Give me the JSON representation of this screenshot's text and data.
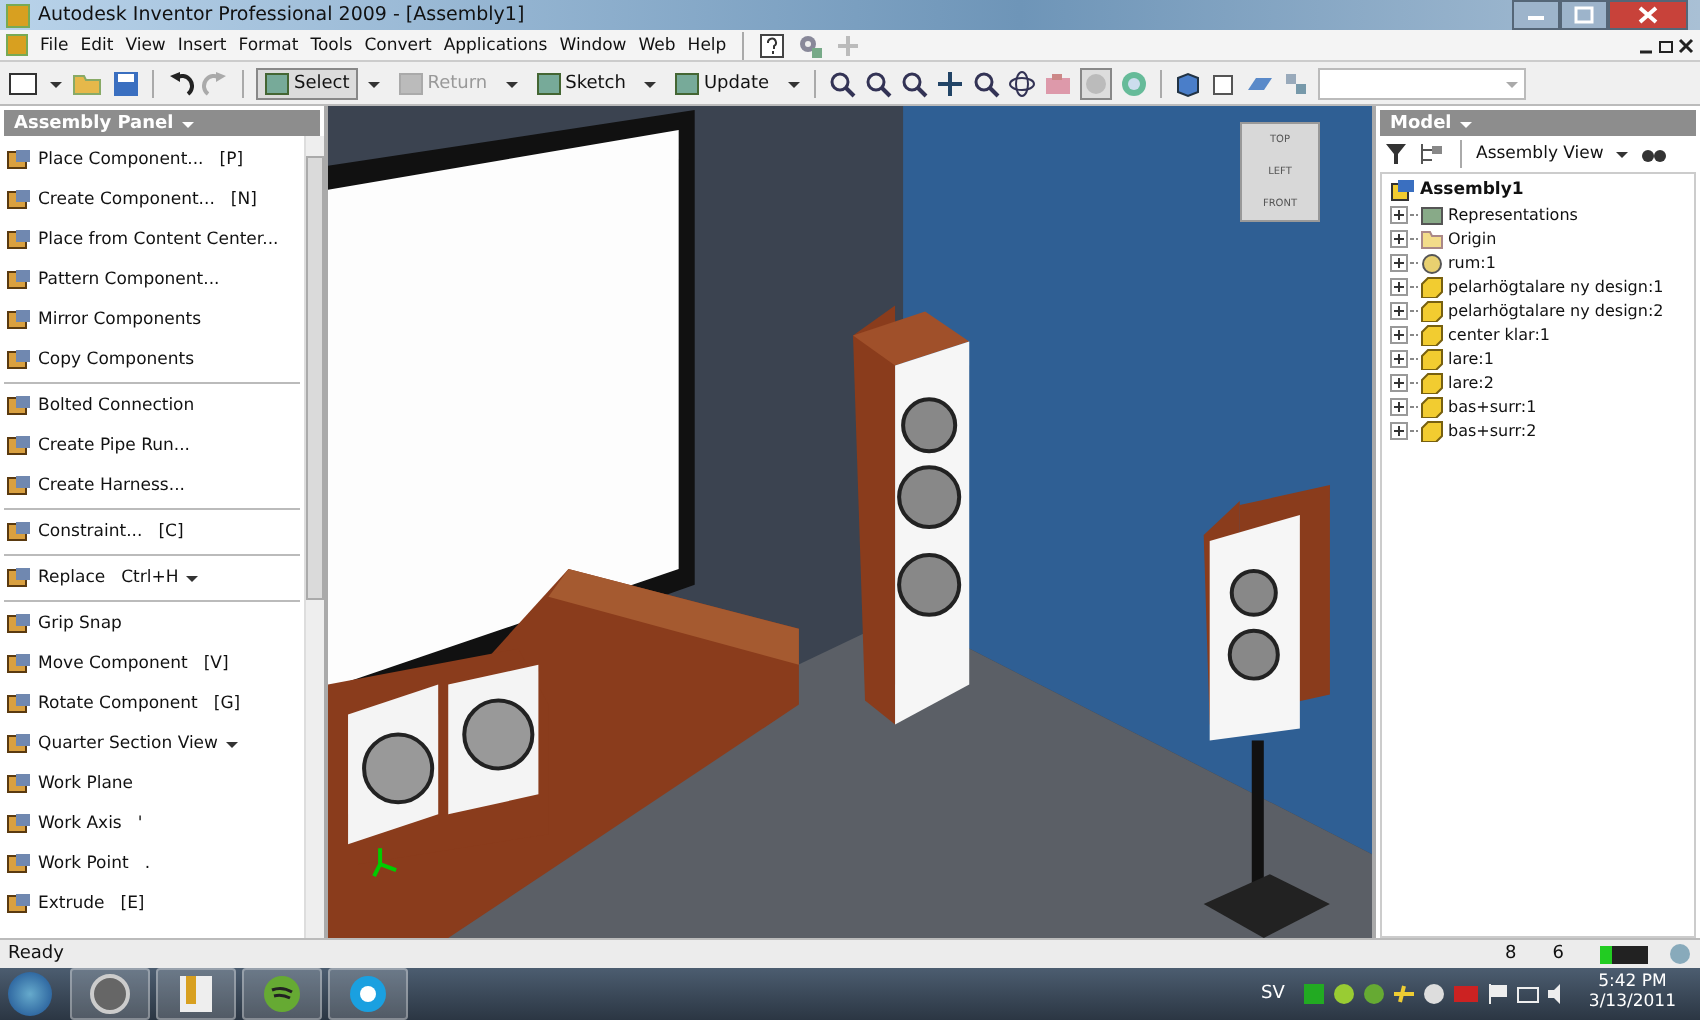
{
  "window": {
    "title": "Autodesk Inventor Professional 2009 - [Assembly1]"
  },
  "menu": [
    "File",
    "Edit",
    "View",
    "Insert",
    "Format",
    "Tools",
    "Convert",
    "Applications",
    "Window",
    "Web",
    "Help"
  ],
  "toolbar": [
    {
      "label": "Select",
      "pressed": true,
      "disabled": false
    },
    {
      "label": "Return",
      "pressed": false,
      "disabled": true
    },
    {
      "label": "Sketch",
      "pressed": false,
      "disabled": false
    },
    {
      "label": "Update",
      "pressed": false,
      "disabled": false
    }
  ],
  "assembly_panel": {
    "title": "Assembly Panel",
    "groups": [
      [
        {
          "label": "Place Component...",
          "shortcut": "[P]",
          "dropdown": false
        },
        {
          "label": "Create Component...",
          "shortcut": "[N]",
          "dropdown": false
        },
        {
          "label": "Place from Content Center...",
          "dropdown": false
        },
        {
          "label": "Pattern Component...",
          "dropdown": false
        },
        {
          "label": "Mirror Components",
          "dropdown": false
        },
        {
          "label": "Copy Components",
          "dropdown": false
        }
      ],
      [
        {
          "label": "Bolted Connection",
          "dropdown": false
        },
        {
          "label": "Create Pipe Run...",
          "dropdown": false
        },
        {
          "label": "Create Harness...",
          "dropdown": false
        }
      ],
      [
        {
          "label": "Constraint...",
          "shortcut": "[C]",
          "dropdown": false
        }
      ],
      [
        {
          "label": "Replace",
          "shortcut": "Ctrl+H",
          "dropdown": true
        }
      ],
      [
        {
          "label": "Grip Snap",
          "dropdown": false
        },
        {
          "label": "Move Component",
          "shortcut": "[V]",
          "dropdown": false
        },
        {
          "label": "Rotate Component",
          "shortcut": "[G]",
          "dropdown": false
        },
        {
          "label": "Quarter Section View",
          "dropdown": true
        },
        {
          "label": "Work Plane",
          "dropdown": false
        },
        {
          "label": "Work Axis",
          "shortcut": "'",
          "dropdown": false
        },
        {
          "label": "Work Point",
          "shortcut": ".",
          "dropdown": false
        },
        {
          "label": "Extrude",
          "shortcut": "[E]",
          "dropdown": false
        }
      ]
    ]
  },
  "viewcube": {
    "faces": [
      "TOP",
      "LEFT",
      "FRONT"
    ]
  },
  "model_panel": {
    "title": "Model",
    "view": "Assembly View",
    "root": {
      "label": "Assembly1",
      "children": [
        {
          "label": "Representations",
          "kind": "representations"
        },
        {
          "label": "Origin",
          "kind": "folder"
        },
        {
          "label": "rum:1",
          "kind": "adaptive"
        },
        {
          "label": "pelarhögtalare ny design:1",
          "kind": "part"
        },
        {
          "label": "pelarhögtalare ny design:2",
          "kind": "part"
        },
        {
          "label": "center klar:1",
          "kind": "part"
        },
        {
          "label": "lare:1",
          "kind": "part"
        },
        {
          "label": "lare:2",
          "kind": "part"
        },
        {
          "label": "bas+surr:1",
          "kind": "part"
        },
        {
          "label": "bas+surr:2",
          "kind": "part"
        }
      ]
    }
  },
  "status_bar": {
    "text": "Ready",
    "count_1": "8",
    "count_2": "6",
    "level": 0.25
  },
  "taskbar": {
    "language": "SV",
    "time": "5:42 PM",
    "date": "3/13/2011"
  }
}
